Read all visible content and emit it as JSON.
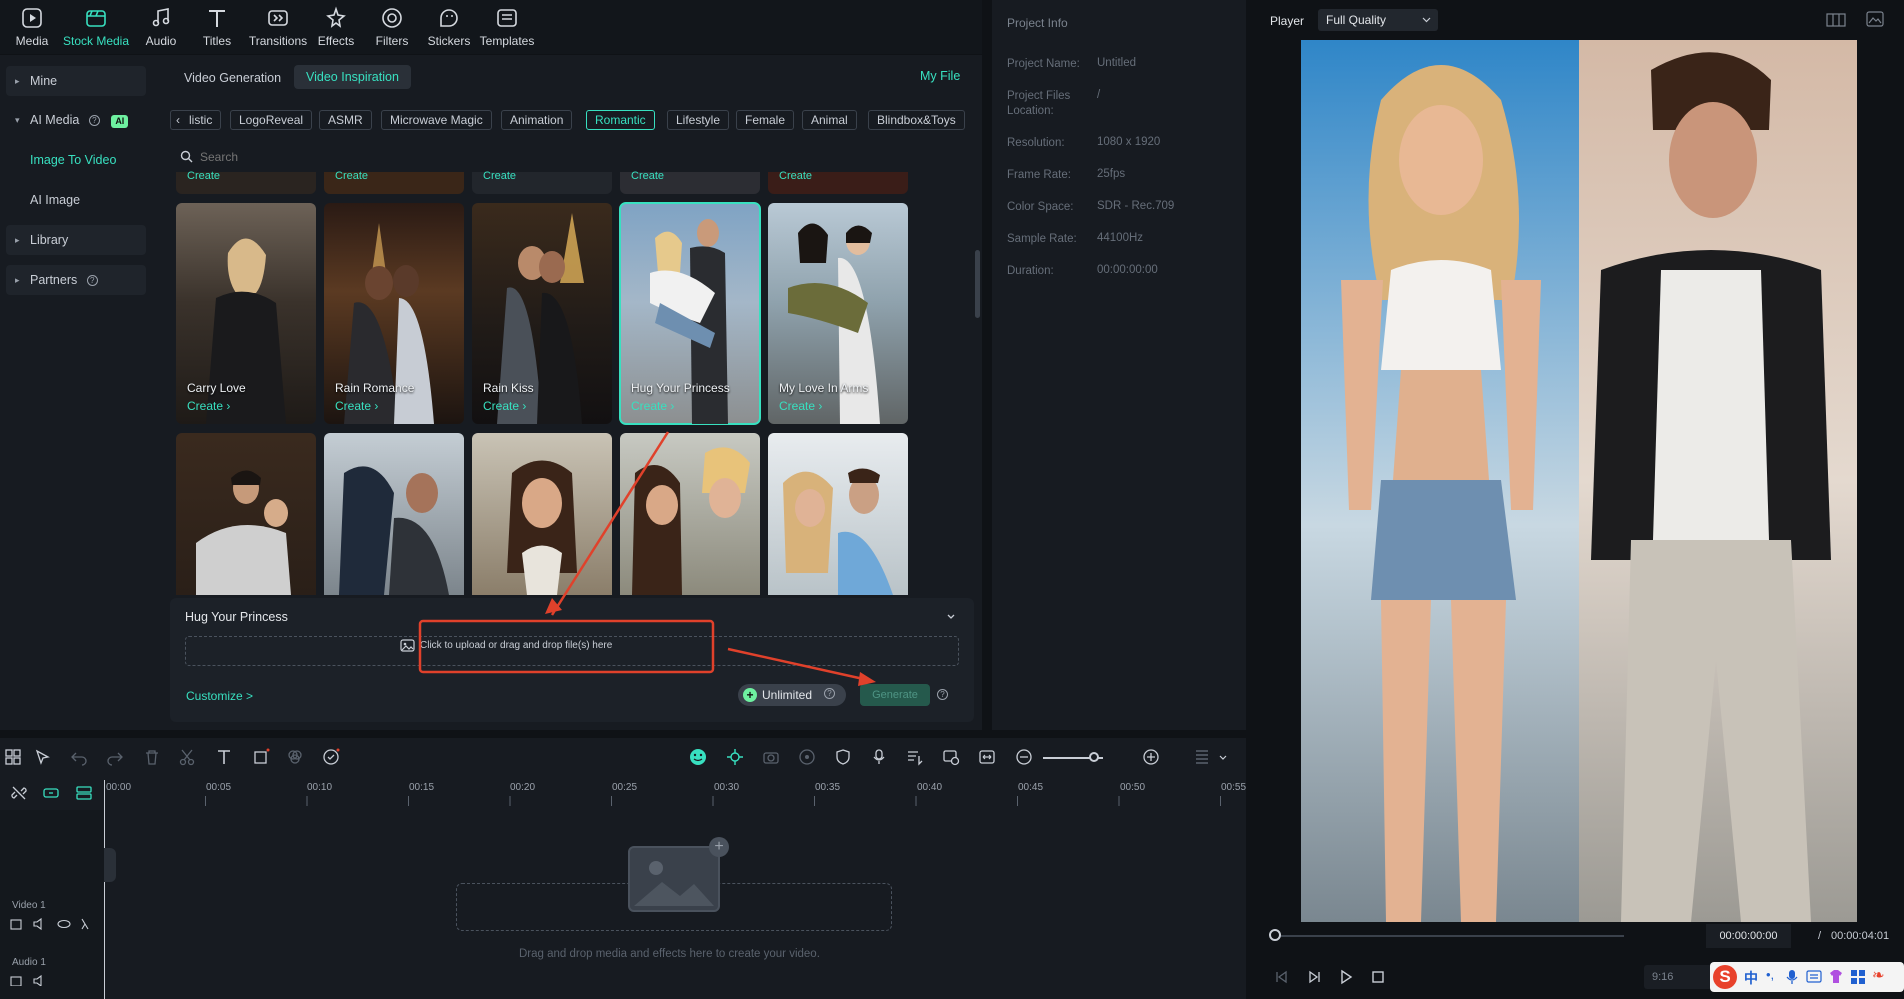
{
  "toolbar": {
    "items": [
      {
        "label": "Media",
        "icon": "media-icon"
      },
      {
        "label": "Stock Media",
        "icon": "stock-media-icon",
        "active": true
      },
      {
        "label": "Audio",
        "icon": "audio-icon"
      },
      {
        "label": "Titles",
        "icon": "titles-icon"
      },
      {
        "label": "Transitions",
        "icon": "transitions-icon"
      },
      {
        "label": "Effects",
        "icon": "effects-icon"
      },
      {
        "label": "Filters",
        "icon": "filters-icon"
      },
      {
        "label": "Stickers",
        "icon": "stickers-icon"
      },
      {
        "label": "Templates",
        "icon": "templates-icon"
      }
    ]
  },
  "leftnav": {
    "mine": "Mine",
    "ai_media": "AI Media",
    "ai_badge": "AI",
    "image_to_video": "Image To Video",
    "ai_image": "AI Image",
    "library": "Library",
    "partners": "Partners"
  },
  "content": {
    "tabs": [
      "Video Generation",
      "Video Inspiration"
    ],
    "my_file": "My File",
    "chips": [
      "listic",
      "LogoReveal",
      "ASMR",
      "Microwave Magic",
      "Animation",
      "Romantic",
      "Lifestyle",
      "Female",
      "Animal",
      "Blindbox&Toys"
    ],
    "active_chip": "Romantic",
    "search_placeholder": "Search",
    "create_label": "Create",
    "row1": [
      {
        "title": "Carry Love"
      },
      {
        "title": "Rain Romance"
      },
      {
        "title": "Rain Kiss"
      },
      {
        "title": "Hug Your Princess"
      },
      {
        "title": "My Love In Arms"
      }
    ],
    "panel_title": "Hug Your Princess",
    "upload_text": "Click to upload or drag and drop file(s) here",
    "customize": "Customize >",
    "unlimited": "Unlimited",
    "generate": "Generate"
  },
  "project_info": {
    "header": "Project Info",
    "rows": [
      {
        "label": "Project Name:",
        "value": "Untitled"
      },
      {
        "label": "Project Files Location:",
        "value": "/"
      },
      {
        "label": "Resolution:",
        "value": "1080 x 1920"
      },
      {
        "label": "Frame Rate:",
        "value": "25fps"
      },
      {
        "label": "Color Space:",
        "value": "SDR - Rec.709"
      },
      {
        "label": "Sample Rate:",
        "value": "44100Hz"
      },
      {
        "label": "Duration:",
        "value": "00:00:00:00"
      }
    ]
  },
  "player": {
    "label": "Player",
    "quality": "Full Quality",
    "current_time": "00:00:00:00",
    "separator": "/",
    "total_time": "00:00:04:01",
    "aspect": "9:16"
  },
  "timeline": {
    "ticks": [
      "00:00",
      "00:05",
      "00:10",
      "00:15",
      "00:20",
      "00:25",
      "00:30",
      "00:35",
      "00:40",
      "00:45",
      "00:50",
      "00:55"
    ],
    "video_track": "Video 1",
    "audio_track": "Audio 1",
    "drop_hint": "Drag and drop media and effects here to create your video."
  },
  "colors": {
    "accent": "#38e0c0",
    "annotation": "#e0412b"
  }
}
